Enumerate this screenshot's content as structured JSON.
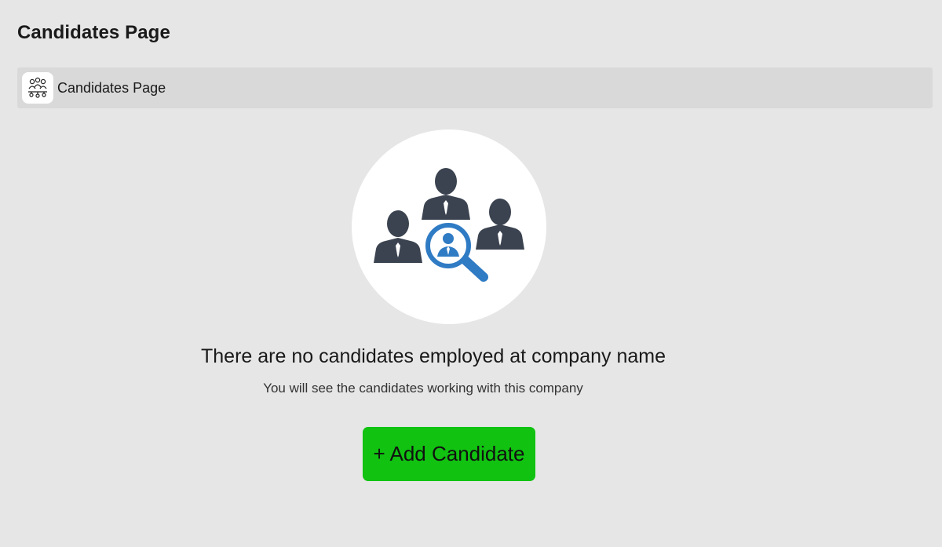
{
  "page": {
    "title": "Candidates Page"
  },
  "breadcrumb": {
    "icon": "people-network-icon",
    "label": "Candidates Page"
  },
  "empty_state": {
    "icon": "candidate-search-icon",
    "title": "There are no candidates employed at company name",
    "subtitle": "You will see the candidates working with this company",
    "button_label": "+ Add Candidate"
  },
  "colors": {
    "background": "#e6e6e6",
    "breadcrumb_bar": "#d9d9d9",
    "button": "#11c211",
    "person": "#3b4350",
    "magnifier": "#2f7bc4"
  }
}
